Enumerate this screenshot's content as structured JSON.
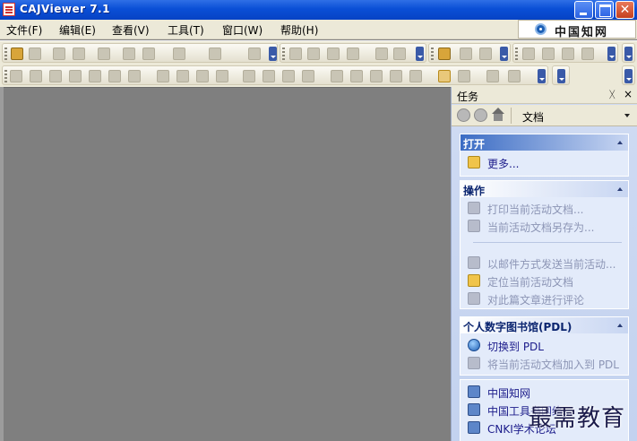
{
  "window": {
    "title": "CAJViewer 7.1",
    "close_glyph": "✕"
  },
  "menu": {
    "items": [
      "文件(F)",
      "编辑(E)",
      "查看(V)",
      "工具(T)",
      "窗口(W)",
      "帮助(H)"
    ],
    "logo_text": "中国知网"
  },
  "task_pane": {
    "title": "任务",
    "pin_glyph": "ᚷ",
    "close_glyph": "×",
    "nav_doc_label": "文档",
    "sections": {
      "open": {
        "title": "打开",
        "items": [
          "更多..."
        ]
      },
      "ops": {
        "title": "操作",
        "items": [
          "打印当前活动文档...",
          "当前活动文档另存为...",
          "以邮件方式发送当前活动...",
          "定位当前活动文档",
          "对此篇文章进行评论"
        ]
      },
      "pdl": {
        "title": "个人数字图书馆(PDL)",
        "items": [
          "切换到 PDL",
          "将当前活动文档加入到 PDL"
        ]
      },
      "links": {
        "items": [
          "中国知网",
          "中国工具书网络...",
          "CNKI学术论坛"
        ]
      }
    }
  },
  "watermark": "最需教育"
}
